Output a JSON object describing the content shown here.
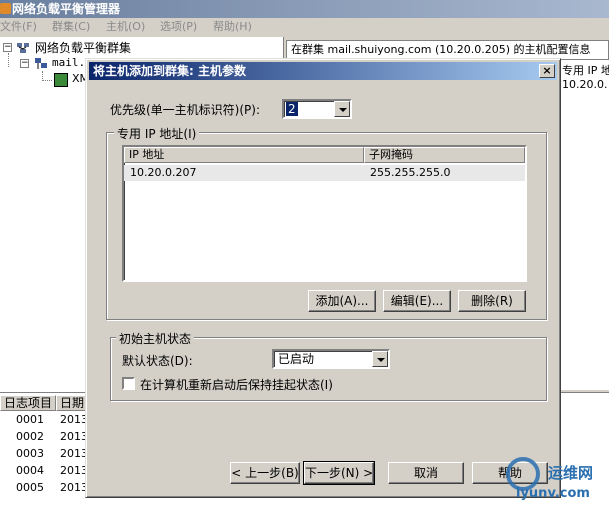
{
  "app": {
    "title": "网络负载平衡管理器",
    "menu": [
      "文件(F)",
      "群集(C)",
      "主机(O)",
      "选项(P)",
      "帮助(H)"
    ],
    "tree": {
      "root": "网络负载平衡群集",
      "cluster": "mail.",
      "host": "XM"
    },
    "info_bar": "在群集 mail.shuiyong.com (10.20.0.205) 的主机配置信息",
    "right_col_header": "专用 IP 地",
    "right_col_value": "10.20.0.",
    "log_headers": [
      "日志项目",
      "日期"
    ],
    "log_rows": [
      {
        "id": "0001",
        "date": "2013"
      },
      {
        "id": "0002",
        "date": "2013"
      },
      {
        "id": "0003",
        "date": "2013"
      },
      {
        "id": "0004",
        "date": "2013"
      },
      {
        "id": "0005",
        "date": "2013"
      }
    ]
  },
  "dialog": {
    "title": "将主机添加到群集: 主机参数",
    "close_glyph": "×",
    "priority_label": "优先级(单一主机标识符)(P):",
    "priority_value": "2",
    "dedicated_group": "专用 IP 地址(I)",
    "columns": [
      "IP 地址",
      "子网掩码"
    ],
    "rows": [
      {
        "ip": "10.20.0.207",
        "mask": "255.255.255.0"
      }
    ],
    "add_button": "添加(A)...",
    "edit_button": "编辑(E)...",
    "remove_button": "删除(R)",
    "initial_state_group": "初始主机状态",
    "default_state_label": "默认状态(D):",
    "default_state_value": "已启动",
    "persist_checkbox_label": "在计算机重新启动后保持挂起状态(I)",
    "persist_checked": false,
    "back_button": "< 上一步(B)",
    "next_button": "下一步(N) >",
    "cancel_button": "取消",
    "help_button": "帮助"
  },
  "watermark": {
    "text": "运维网",
    "url": "iyunv.com"
  },
  "colors": {
    "titlebar_active": "#0a246a",
    "selection": "#0a246a",
    "face": "#d4d0c8",
    "watermark": "#2a6fb0"
  }
}
